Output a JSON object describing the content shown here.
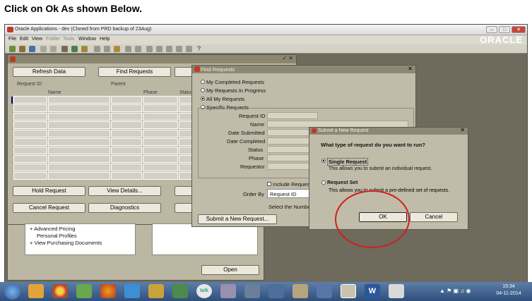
{
  "caption": "Click on Ok As shown Below.",
  "app": {
    "title": "Oracle Applications - dev (Cloned from PRD backup of 23Aug)",
    "menu": [
      "File",
      "Edit",
      "View",
      "Folder",
      "Tools",
      "Window",
      "Help"
    ],
    "logo": "ORACLE"
  },
  "requests_window": {
    "buttons": {
      "refresh": "Refresh Data",
      "find": "Find Requests",
      "hold": "Hold Request",
      "view_details": "View Details...",
      "cancel": "Cancel Request",
      "diagnostics": "Diagnostics"
    },
    "columns": {
      "request_id": "Request ID",
      "parent": "Parent",
      "name": "Name",
      "phase": "Phase",
      "status": "Status"
    }
  },
  "lower_window": {
    "tree": [
      "Advanced Pricing",
      "Personal Profiles",
      "View Purchasing Documents"
    ],
    "open_button": "Open"
  },
  "find_dialog": {
    "title": "Find Requests",
    "options": [
      "My Completed Requests",
      "My Requests In Progress",
      "All My Requests",
      "Specific Requests"
    ],
    "fields": [
      "Request ID",
      "Name",
      "Date Submitted",
      "Date Completed",
      "Status",
      "Phase",
      "Requestor"
    ],
    "include_label": "Include Request",
    "order_by_label": "Order By",
    "order_by_value": "Request ID",
    "select_label": "Select the Number",
    "submit_button": "Submit a New Request..."
  },
  "submit_dialog": {
    "title": "Submit a New Request",
    "question": "What type of request do you want to run?",
    "single": {
      "label": "Single Request",
      "desc": "This allows you to submit an individual request."
    },
    "set": {
      "label": "Request Set",
      "desc": "This allows you to submit a pre-defined set of requests."
    },
    "ok": "OK",
    "cancel": "Cancel"
  },
  "taskbar": {
    "time": "15:34",
    "date": "04-11-2014"
  },
  "colors": {
    "annotation": "#d0201c",
    "oracle_red": "#c0392b"
  }
}
